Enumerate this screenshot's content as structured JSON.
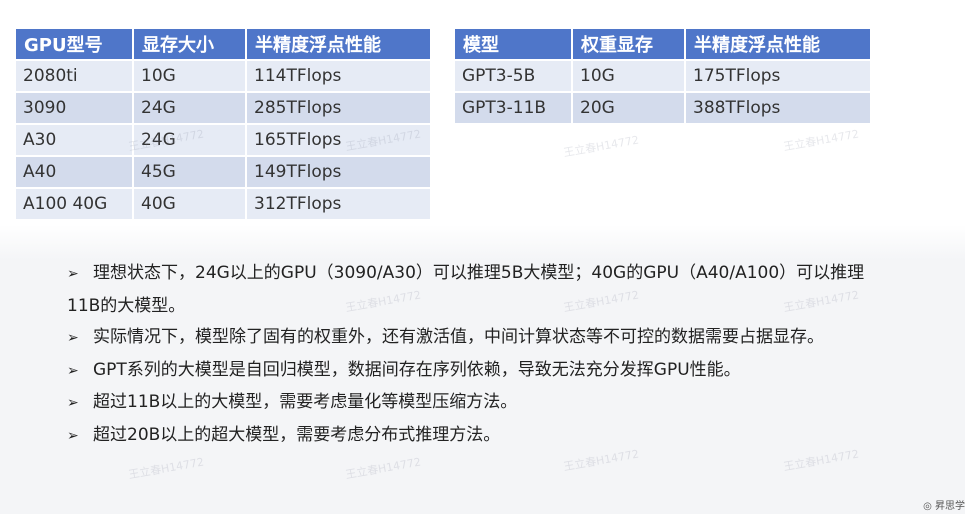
{
  "gpu_table": {
    "headers": [
      "GPU型号",
      "显存大小",
      "半精度浮点性能"
    ],
    "rows": [
      [
        "2080ti",
        "10G",
        "114TFlops"
      ],
      [
        "3090",
        "24G",
        "285TFlops"
      ],
      [
        "A30",
        "24G",
        "165TFlops"
      ],
      [
        "A40",
        "45G",
        "149TFlops"
      ],
      [
        "A100 40G",
        "40G",
        "312TFlops"
      ]
    ]
  },
  "model_table": {
    "headers": [
      "模型",
      "权重显存",
      "半精度浮点性能"
    ],
    "rows": [
      [
        "GPT3-5B",
        "10G",
        "175TFlops"
      ],
      [
        "GPT3-11B",
        "20G",
        "388TFlops"
      ]
    ]
  },
  "bullets": [
    "理想状态下，24G以上的GPU（3090/A30）可以推理5B大模型；40G的GPU（A40/A100）可以推理11B的大模型。",
    "实际情况下，模型除了固有的权重外，还有激活值，中间计算状态等不可控的数据需要占据显存。",
    "GPT系列的大模型是自回归模型，数据间存在序列依赖，导致无法充分发挥GPU性能。",
    "超过11B以上的大模型，需要考虑量化等模型压缩方法。",
    "超过20B以上的超大模型，需要考虑分布式推理方法。"
  ],
  "bullet_symbol": "➢",
  "watermark": "王立春H14772",
  "corner_logo": "◎ 昇思学"
}
